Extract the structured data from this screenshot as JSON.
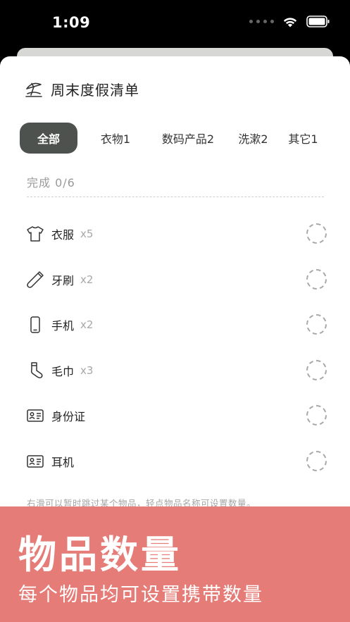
{
  "status": {
    "time": "1:09"
  },
  "header": {
    "title": "周末度假清单",
    "icon": "beach-umbrella-icon"
  },
  "tabs": [
    {
      "label": "全部"
    },
    {
      "label": "衣物1"
    },
    {
      "label": "数码产品2"
    },
    {
      "label": "洗漱2"
    },
    {
      "label": "其它1"
    }
  ],
  "progress": {
    "label": "完成 0/6",
    "fraction": 0
  },
  "items": [
    {
      "name": "衣服",
      "qty": "x5",
      "icon": "tshirt-icon"
    },
    {
      "name": "牙刷",
      "qty": "x2",
      "icon": "toothbrush-icon"
    },
    {
      "name": "手机",
      "qty": "x2",
      "icon": "phone-icon"
    },
    {
      "name": "毛巾",
      "qty": "x3",
      "icon": "sock-icon"
    },
    {
      "name": "身份证",
      "qty": "",
      "icon": "id-card-icon"
    },
    {
      "name": "耳机",
      "qty": "",
      "icon": "id-card-icon"
    }
  ],
  "hint": "右滑可以暂时跳过某个物品，轻点物品名称可设置数量。",
  "banner": {
    "title": "物品数量",
    "subtitle": "每个物品均可设置携带数量",
    "color": "#e57c77"
  }
}
